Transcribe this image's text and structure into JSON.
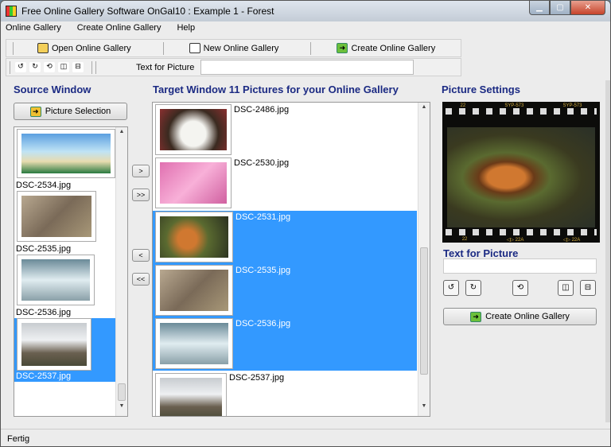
{
  "window": {
    "title": "Free Online Gallery Software OnGal10 : Example 1 - Forest"
  },
  "menu": [
    "Online Gallery",
    "Create Online Gallery",
    "Help"
  ],
  "toolbar": {
    "open": "Open Online Gallery",
    "new": "New Online Gallery",
    "create": "Create Online Gallery",
    "text_label": "Text for Picture",
    "text_value": ""
  },
  "source": {
    "heading": "Source Window",
    "button": "Picture Selection",
    "items": [
      "DSC-2534.jpg",
      "DSC-2535.jpg",
      "DSC-2536.jpg",
      "DSC-2537.jpg"
    ]
  },
  "transfer": {
    "add": ">",
    "add_all": ">>",
    "remove": "<",
    "remove_all": "<<"
  },
  "target": {
    "heading": "Target Window 11 Pictures for your Online Gallery",
    "items": [
      "DSC-2486.jpg",
      "DSC-2530.jpg",
      "DSC-2531.jpg",
      "DSC-2535.jpg",
      "DSC-2536.jpg",
      "DSC-2537.jpg"
    ]
  },
  "settings": {
    "heading": "Picture Settings",
    "text_heading": "Text for Picture",
    "text_value": "",
    "create": "Create Online Gallery",
    "film_top": [
      "22",
      "SYP-573",
      "SYP-573"
    ],
    "film_bottom": [
      "22",
      "◁▷ 22A",
      "◁▷ 22A"
    ]
  },
  "status": "Fertig",
  "colors": {
    "selection": "#3399ff",
    "heading": "#1b2a83"
  }
}
